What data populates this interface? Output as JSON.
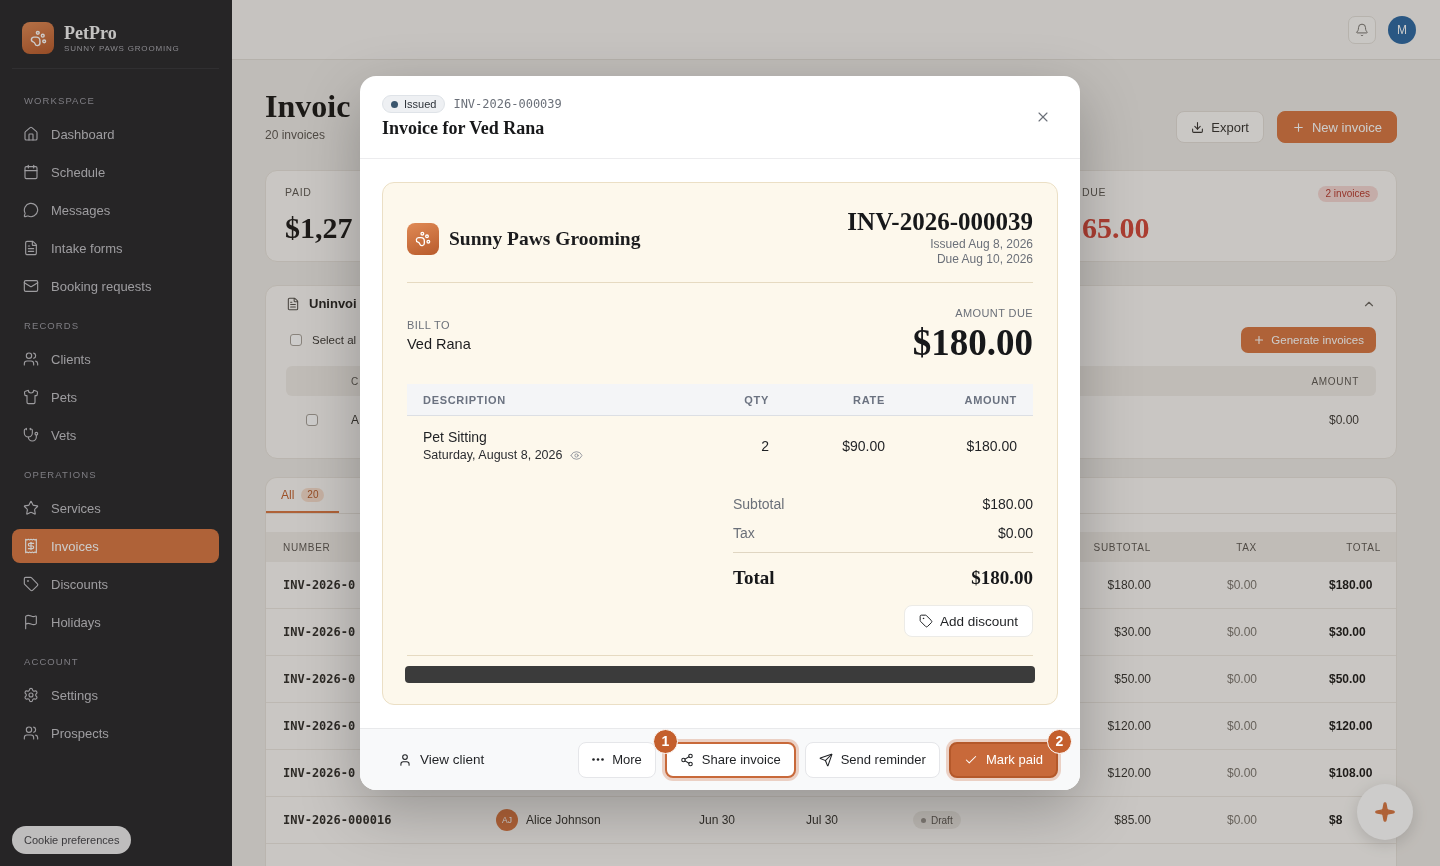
{
  "sidebar": {
    "brand": {
      "name": "PetPro",
      "tagline": "SUNNY PAWS GROOMING"
    },
    "sections": [
      {
        "label": "WORKSPACE",
        "items": [
          {
            "label": "Dashboard",
            "selected": false
          },
          {
            "label": "Schedule",
            "selected": false
          },
          {
            "label": "Messages",
            "selected": false
          },
          {
            "label": "Intake forms",
            "selected": false
          },
          {
            "label": "Booking requests",
            "selected": false
          }
        ]
      },
      {
        "label": "RECORDS",
        "items": [
          {
            "label": "Clients",
            "selected": false
          },
          {
            "label": "Pets",
            "selected": false
          },
          {
            "label": "Vets",
            "selected": false
          }
        ]
      },
      {
        "label": "OPERATIONS",
        "items": [
          {
            "label": "Services",
            "selected": false
          },
          {
            "label": "Invoices",
            "selected": true
          },
          {
            "label": "Discounts",
            "selected": false
          },
          {
            "label": "Holidays",
            "selected": false
          }
        ]
      },
      {
        "label": "ACCOUNT",
        "items": [
          {
            "label": "Settings",
            "selected": false
          },
          {
            "label": "Prospects",
            "selected": false
          }
        ]
      }
    ],
    "cookie_button": "Cookie preferences"
  },
  "top_bar": {
    "avatar_initial": "M"
  },
  "page": {
    "title": "Invoic",
    "subtitle": "20 invoices",
    "actions": [
      {
        "label": "Export",
        "kind": "secondary"
      },
      {
        "label": "New invoice",
        "kind": "primary"
      }
    ],
    "stats": [
      {
        "label": "PAID",
        "value": "$1,27",
        "overdue": false
      },
      {
        "label": "DUE",
        "value": "65.00",
        "overdue": true,
        "badge": "2 invoices"
      }
    ]
  },
  "uninvoiced": {
    "title": "Uninvoi",
    "expanded": true,
    "select_all": {
      "label": "Select al",
      "checked": false
    },
    "generate_button": "Generate invoices",
    "columns": [
      "C",
      "AMOUNT"
    ],
    "rows": [
      {
        "checked": false,
        "column_2": "A",
        "amount": "$0.00"
      }
    ]
  },
  "invoices": {
    "tabs": [
      {
        "label": "All",
        "count": "20",
        "selected": true
      }
    ],
    "columns": {
      "number": "NUMBER",
      "subtotal": "SUBTOTAL",
      "tax": "TAX",
      "total": "TOTAL"
    },
    "rows": [
      {
        "number": "INV-2026-0",
        "subtotal": "$180.00",
        "tax": "$0.00",
        "total": "$180.00"
      },
      {
        "number": "INV-2026-0",
        "subtotal": "$30.00",
        "tax": "$0.00",
        "total": "$30.00"
      },
      {
        "number": "INV-2026-0",
        "subtotal": "$50.00",
        "tax": "$0.00",
        "total": "$50.00"
      },
      {
        "number": "INV-2026-0",
        "subtotal": "$120.00",
        "tax": "$0.00",
        "total": "$120.00"
      },
      {
        "number": "INV-2026-0",
        "subtotal": "$120.00",
        "tax": "$0.00",
        "total": "$108.00"
      },
      {
        "number": "INV-2026-000016",
        "client_initials": "AJ",
        "client": "Alice Johnson",
        "issued": "Jun 30",
        "due": "Jul 30",
        "status": "Draft",
        "subtotal": "$85.00",
        "tax": "$0.00",
        "total": "$8"
      }
    ]
  },
  "modal": {
    "status": {
      "label": "Issued",
      "kind": "issued"
    },
    "number": "INV-2026-000039",
    "title": "Invoice for Ved Rana",
    "invoice": {
      "business": "Sunny Paws Grooming",
      "number": "INV-2026-000039",
      "issued": "Issued Aug 8, 2026",
      "due": "Due Aug 10, 2026",
      "bill_to_label": "BILL TO",
      "bill_to": "Ved Rana",
      "amount_due_label": "AMOUNT DUE",
      "amount_due": "$180.00",
      "columns": [
        "DESCRIPTION",
        "QTY",
        "RATE",
        "AMOUNT"
      ],
      "lines": [
        {
          "description": "Pet Sitting",
          "date": "Saturday, August 8, 2026",
          "qty": "2",
          "rate": "$90.00",
          "amount": "$180.00"
        }
      ],
      "totals": [
        {
          "label": "Subtotal",
          "value": "$180.00",
          "kind": "line"
        },
        {
          "label": "Tax",
          "value": "$0.00",
          "kind": "line"
        },
        {
          "label": "Total",
          "value": "$180.00",
          "kind": "grand"
        }
      ],
      "discount_button": "Add discount"
    },
    "footer": {
      "view_client": "View client",
      "actions": [
        {
          "label": "More",
          "kind": "outline",
          "highlighted": false
        },
        {
          "label": "Share invoice",
          "kind": "outline",
          "highlighted": true,
          "marker": "1"
        },
        {
          "label": "Send reminder",
          "kind": "outline",
          "highlighted": false
        },
        {
          "label": "Mark paid",
          "kind": "primary",
          "highlighted": true,
          "marker": "2"
        }
      ]
    }
  }
}
